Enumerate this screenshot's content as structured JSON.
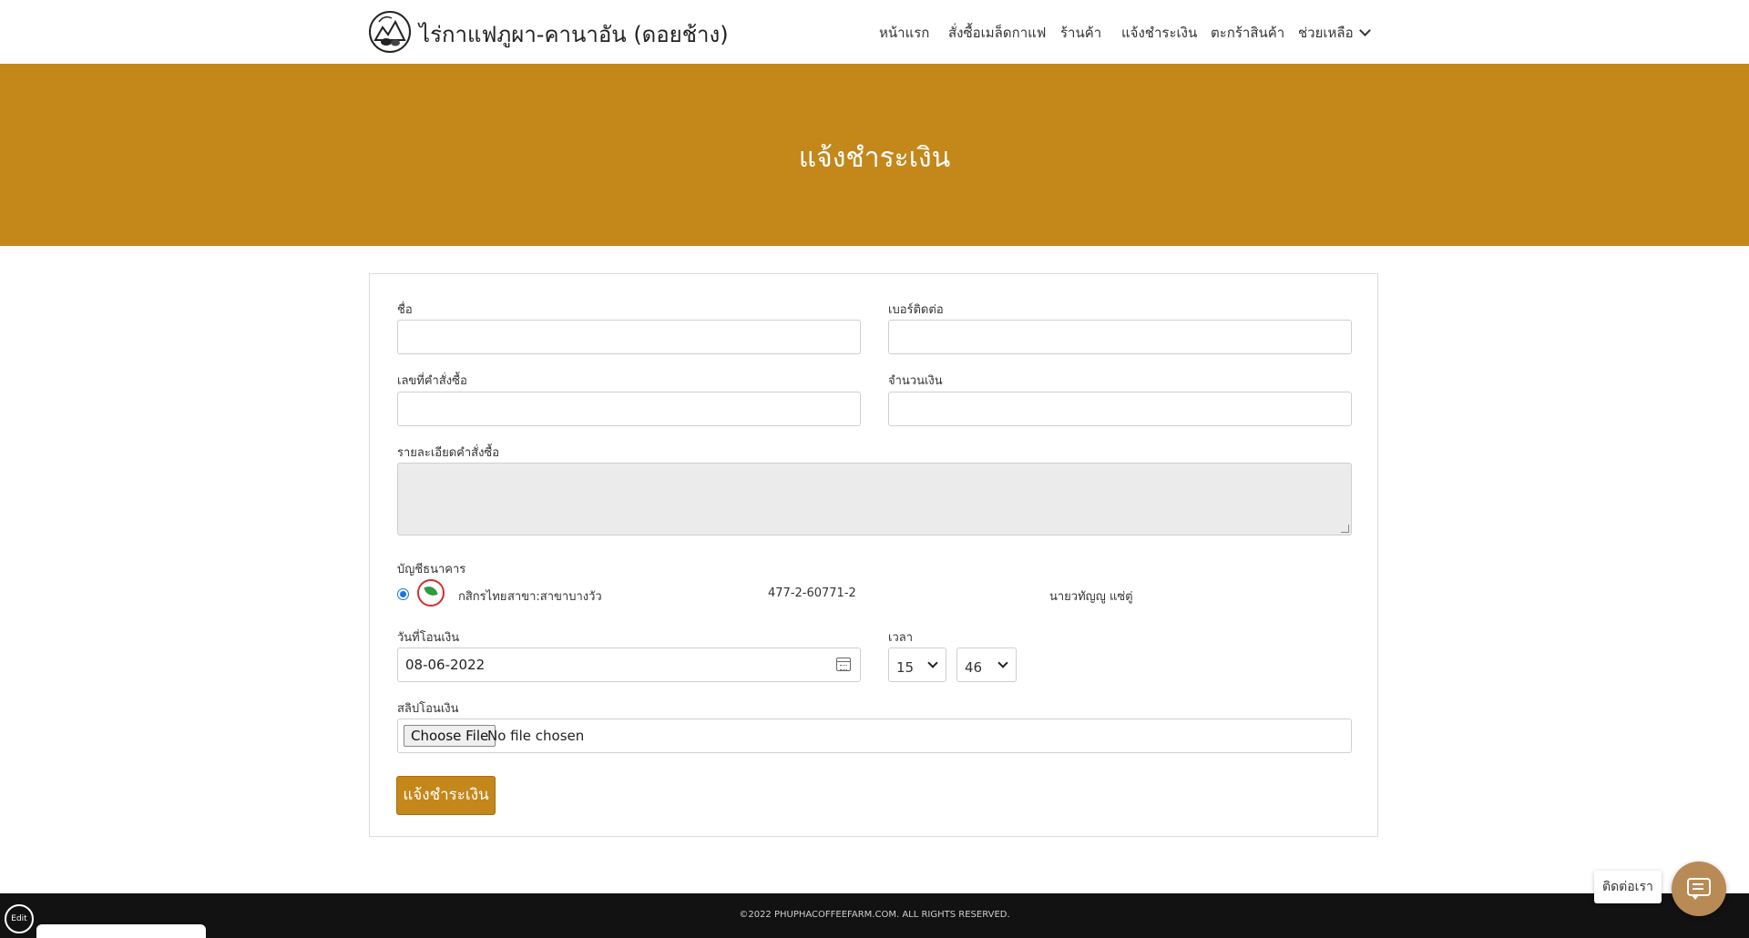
{
  "header": {
    "brand": "ไร่กาแฟภูผา-คานาอัน (ดอยช้าง)",
    "nav": [
      "หน้าแรก",
      "สั่งซื้อเมล็ดกาแฟ",
      "ร้านค้า",
      "แจ้งชำระเงิน",
      "ตะกร้าสินค้า",
      "ช่วยเหลือ"
    ]
  },
  "banner": {
    "title": "แจ้งชำระเงิน"
  },
  "form": {
    "name_label": "ชื่อ",
    "name_value": "",
    "phone_label": "เบอร์ติดต่อ",
    "phone_value": "",
    "order_no_label": "เลขที่คำสั่งซื้อ",
    "order_no_value": "",
    "amount_label": "จำนวนเงิน",
    "amount_value": "",
    "order_detail_label": "รายละเอียดคำสั่งซื้อ",
    "bank_label": "บัญชีธนาคาร",
    "bank": {
      "name": "กสิกรไทย",
      "branch": "สาขา:สาขาบางวัว",
      "account_no": "477-2-60771-2",
      "account_name": "นายวทัญญู แซ่ตู่"
    },
    "transfer_date_label": "วันที่โอนเงิน",
    "transfer_date": "08-06-2022",
    "time_label": "เวลา",
    "hour": "15",
    "minute": "46",
    "slip_label": "สลิปโอนเงิน",
    "file_button": "Choose File",
    "file_status": "No file chosen",
    "submit": "แจ้งชำระเงิน"
  },
  "footer": {
    "copyright": "©2022 PHUPHACOFFEEFARM.COM. ALL RIGHTS RESERVED."
  },
  "widgets": {
    "edit": "Edit",
    "contact": "ติดต่อเรา"
  },
  "colors": {
    "accent": "#c4871a",
    "chat": "#b88a55",
    "footer": "#121212"
  }
}
